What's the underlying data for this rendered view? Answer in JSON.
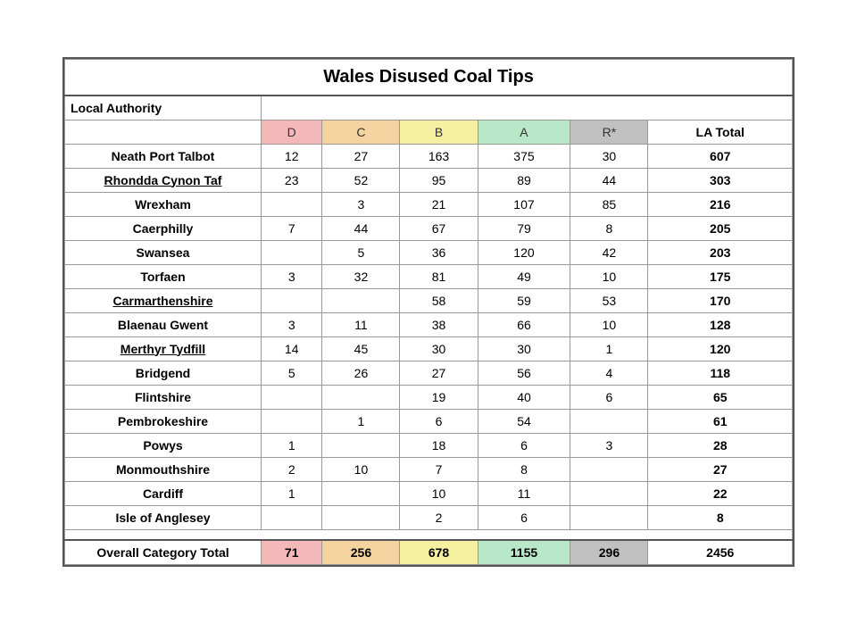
{
  "title": "Wales Disused Coal Tips",
  "columns": {
    "local_auth": "Local Authority",
    "d": "D",
    "c": "C",
    "b": "B",
    "a": "A",
    "r": "R*",
    "total": "LA Total"
  },
  "rows": [
    {
      "name": "Neath Port Talbot",
      "d": "12",
      "c": "27",
      "b": "163",
      "a": "375",
      "r": "30",
      "total": "607",
      "underline": false
    },
    {
      "name": "Rhondda Cynon Taf",
      "d": "23",
      "c": "52",
      "b": "95",
      "a": "89",
      "r": "44",
      "total": "303",
      "underline": true
    },
    {
      "name": "Wrexham",
      "d": "",
      "c": "3",
      "b": "21",
      "a": "107",
      "r": "85",
      "total": "216",
      "underline": false
    },
    {
      "name": "Caerphilly",
      "d": "7",
      "c": "44",
      "b": "67",
      "a": "79",
      "r": "8",
      "total": "205",
      "underline": false
    },
    {
      "name": "Swansea",
      "d": "",
      "c": "5",
      "b": "36",
      "a": "120",
      "r": "42",
      "total": "203",
      "underline": false
    },
    {
      "name": "Torfaen",
      "d": "3",
      "c": "32",
      "b": "81",
      "a": "49",
      "r": "10",
      "total": "175",
      "underline": false
    },
    {
      "name": "Carmarthenshire",
      "d": "",
      "c": "",
      "b": "58",
      "a": "59",
      "r": "53",
      "total": "170",
      "underline": true
    },
    {
      "name": "Blaenau Gwent",
      "d": "3",
      "c": "11",
      "b": "38",
      "a": "66",
      "r": "10",
      "total": "128",
      "underline": false
    },
    {
      "name": "Merthyr Tydfill",
      "d": "14",
      "c": "45",
      "b": "30",
      "a": "30",
      "r": "1",
      "total": "120",
      "underline": true
    },
    {
      "name": "Bridgend",
      "d": "5",
      "c": "26",
      "b": "27",
      "a": "56",
      "r": "4",
      "total": "118",
      "underline": false
    },
    {
      "name": "Flintshire",
      "d": "",
      "c": "",
      "b": "19",
      "a": "40",
      "r": "6",
      "total": "65",
      "underline": false
    },
    {
      "name": "Pembrokeshire",
      "d": "",
      "c": "1",
      "b": "6",
      "a": "54",
      "r": "",
      "total": "61",
      "underline": false
    },
    {
      "name": "Powys",
      "d": "1",
      "c": "",
      "b": "18",
      "a": "6",
      "r": "3",
      "total": "28",
      "underline": false
    },
    {
      "name": "Monmouthshire",
      "d": "2",
      "c": "10",
      "b": "7",
      "a": "8",
      "r": "",
      "total": "27",
      "underline": false
    },
    {
      "name": "Cardiff",
      "d": "1",
      "c": "",
      "b": "10",
      "a": "11",
      "r": "",
      "total": "22",
      "underline": false
    },
    {
      "name": "Isle of Anglesey",
      "d": "",
      "c": "",
      "b": "2",
      "a": "6",
      "r": "",
      "total": "8",
      "underline": false
    }
  ],
  "totals": {
    "label": "Overall Category Total",
    "d": "71",
    "c": "256",
    "b": "678",
    "a": "1155",
    "r": "296",
    "total": "2456"
  }
}
